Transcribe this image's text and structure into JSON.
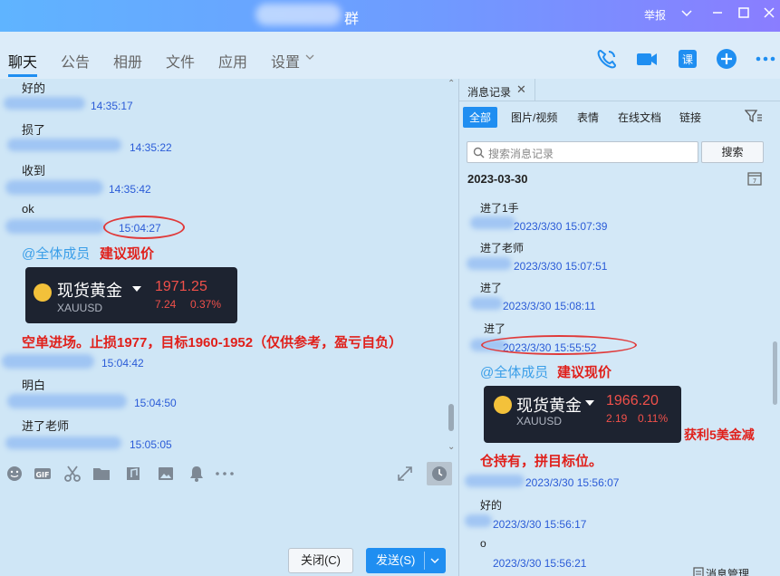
{
  "titlebar": {
    "group_suffix": "群",
    "report": "举报",
    "controls": [
      "﹀",
      "—",
      "☐",
      "✕"
    ]
  },
  "tabs": [
    "聊天",
    "公告",
    "相册",
    "文件",
    "应用",
    "设置"
  ],
  "tabs_active_index": 0,
  "chat": {
    "messages": [
      {
        "text": "好的",
        "time": "14:35:17"
      },
      {
        "text": "损了",
        "time": "14:35:22"
      },
      {
        "text": "收到",
        "time": "14:35:42"
      },
      {
        "text": "ok",
        "time": "15:04:27"
      }
    ],
    "mention": "@全体成员",
    "advice": "建议现价",
    "card": {
      "name": "现货黄金",
      "symbol": "XAUUSD",
      "price": "1971.25",
      "change": "7.24",
      "pct": "0.37%"
    },
    "strategy": "空单进场。止损1977，目标1960-1952（仅供参考，盈亏自负）",
    "time_after_strategy": "15:04:42",
    "msg2_text": "明白",
    "msg2_time": "15:04:50",
    "msg3_text": "进了老师",
    "msg3_time": "15:05:05"
  },
  "buttons": {
    "close": "关闭(C)",
    "send": "发送(S)"
  },
  "history": {
    "tab_label": "消息记录",
    "filters": [
      "全部",
      "图片/视频",
      "表情",
      "在线文档",
      "链接"
    ],
    "search_placeholder": "搜索消息记录",
    "search_button": "搜索",
    "date": "2023-03-30",
    "entries": [
      {
        "text": "进了1手",
        "time": "2023/3/30 15:07:39"
      },
      {
        "text": "进了老师",
        "time": "2023/3/30 15:07:51"
      },
      {
        "text": "进了",
        "time": "2023/3/30 15:08:11"
      },
      {
        "text": "进了",
        "time": "2023/3/30 15:55:52"
      }
    ],
    "mention": "@全体成员",
    "advice": "建议现价",
    "card": {
      "name": "现货黄金",
      "symbol": "XAUUSD",
      "price": "1966.20",
      "change": "2.19",
      "pct": "0.11%"
    },
    "profit_note": "获利5美金减",
    "hold_note": "仓持有，拼目标位。",
    "after_time": "2023/3/30 15:56:07",
    "entry5_text": "好的",
    "entry5_time": "2023/3/30 15:56:17",
    "entry6_text": "o",
    "entry6_time": "2023/3/30 15:56:21",
    "manage": "消息管理"
  },
  "colors": {
    "accent": "#1f8ef1",
    "red": "#e0201b",
    "time": "#2a5bd7"
  }
}
